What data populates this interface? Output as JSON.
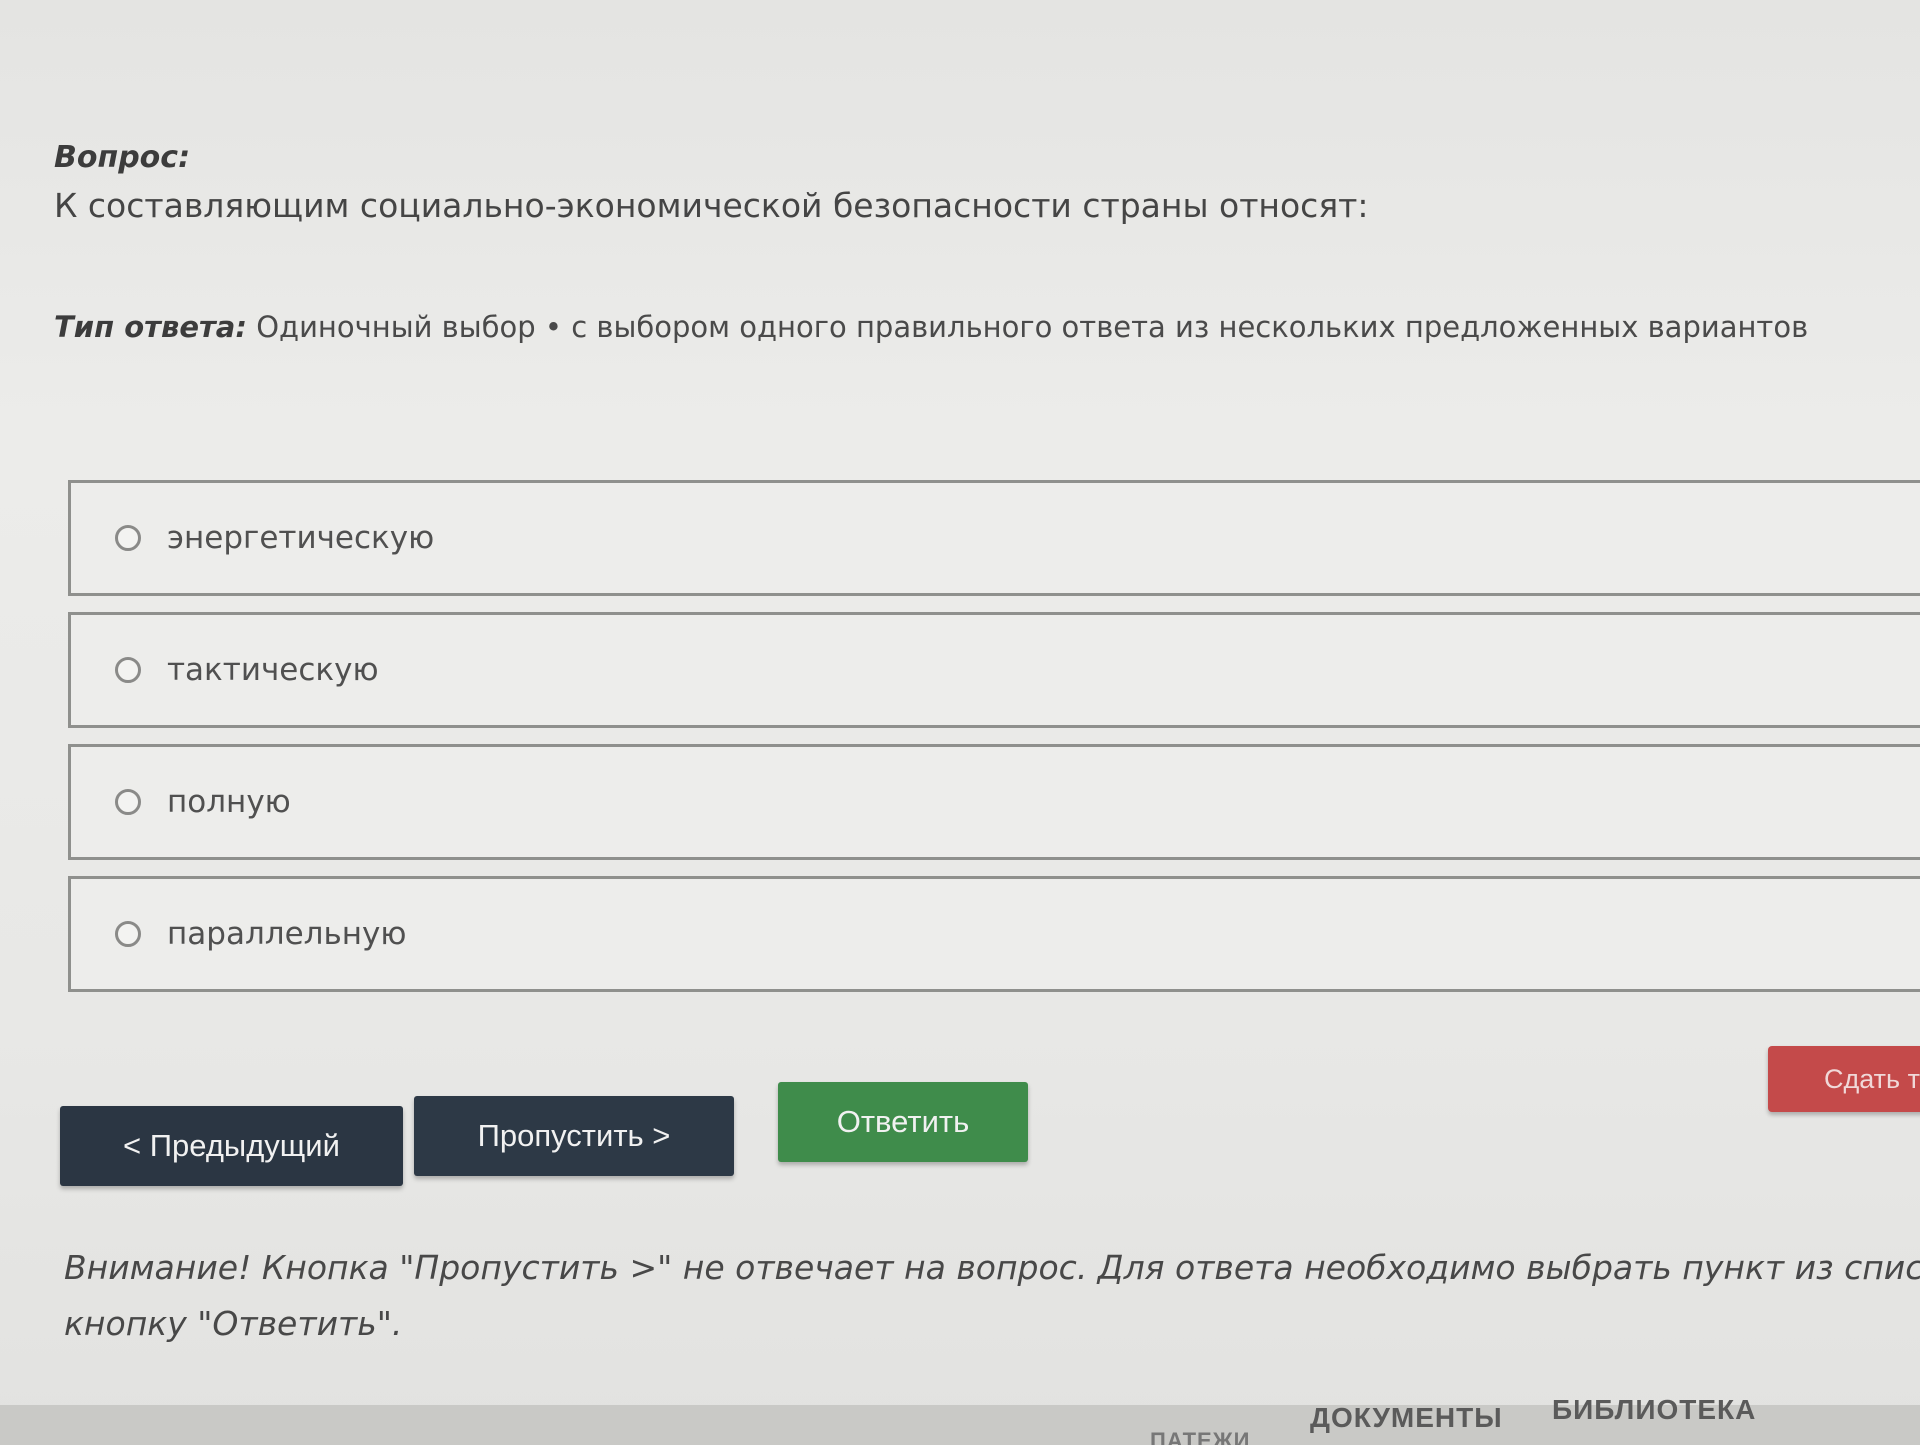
{
  "question": {
    "label": "Вопрос:",
    "text": "К составляющим социально-экономической безопасности страны относят:"
  },
  "answer_type": {
    "label": "Тип ответа:",
    "value": "Одиночный выбор • с выбором одного правильного ответа из нескольких предложенных вариантов"
  },
  "options": [
    {
      "label": "энергетическую"
    },
    {
      "label": "тактическую"
    },
    {
      "label": "полную"
    },
    {
      "label": "параллельную"
    }
  ],
  "buttons": {
    "prev": "< Предыдущий",
    "skip": "Пропустить >",
    "answer": "Ответить",
    "submit": "Сдать те"
  },
  "notice": {
    "line1": "Внимание! Кнопка \"Пропустить >\" не отвечает на вопрос. Для ответа необходимо выбрать пункт из списка и нажат",
    "line2": "кнопку \"Ответить\"."
  },
  "footer": {
    "partial": "ПАТЕЖИ",
    "docs": "ДОКУМЕНТЫ",
    "library": "БИБЛИОТЕКА"
  },
  "colors": {
    "dark_button": "#2b3643",
    "answer_button": "#3f8c4b",
    "submit_button": "#c44a4a"
  }
}
